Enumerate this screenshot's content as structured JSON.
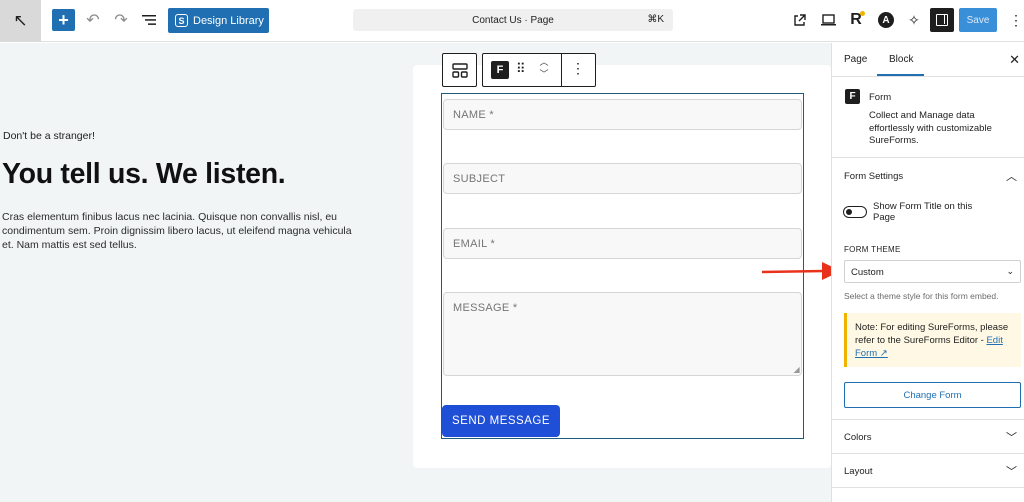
{
  "topbar": {
    "add_icon": "plus-icon",
    "design_library_label": "Design Library",
    "document_title": "Contact Us · Page",
    "shortcut": "⌘K",
    "save_label": "Save"
  },
  "canvas": {
    "eyebrow": "Don't be a stranger!",
    "headline": "You tell us. We listen.",
    "body": "Cras elementum finibus lacus nec lacinia. Quisque non convallis nisl, eu condimentum sem. Proin dignissim libero lacus, ut eleifend magna vehicula et. Nam mattis est sed tellus."
  },
  "form": {
    "fields": {
      "name": "NAME *",
      "subject": "SUBJECT",
      "email": "EMAIL *",
      "message": "MESSAGE *"
    },
    "submit_label": "SEND MESSAGE"
  },
  "sidebar": {
    "tabs": {
      "page": "Page",
      "block": "Block"
    },
    "block": {
      "title": "Form",
      "description": "Collect and Manage data effortlessly with customizable SureForms."
    },
    "form_settings": {
      "heading": "Form Settings",
      "toggle_label": "Show Form Title on this Page",
      "theme_label": "FORM THEME",
      "theme_value": "Custom",
      "theme_help": "Select a theme style for this form embed.",
      "notice_text": "Note: For editing SureForms, please refer to the SureForms Editor - ",
      "notice_link": "Edit Form ↗",
      "change_form_label": "Change Form"
    },
    "panels": {
      "colors": "Colors",
      "layout": "Layout"
    }
  },
  "colors": {
    "accent": "#1f6fb2",
    "send_button": "#1f4fd6",
    "arrow": "#e8321c",
    "notice_bg": "#fff8e4"
  }
}
